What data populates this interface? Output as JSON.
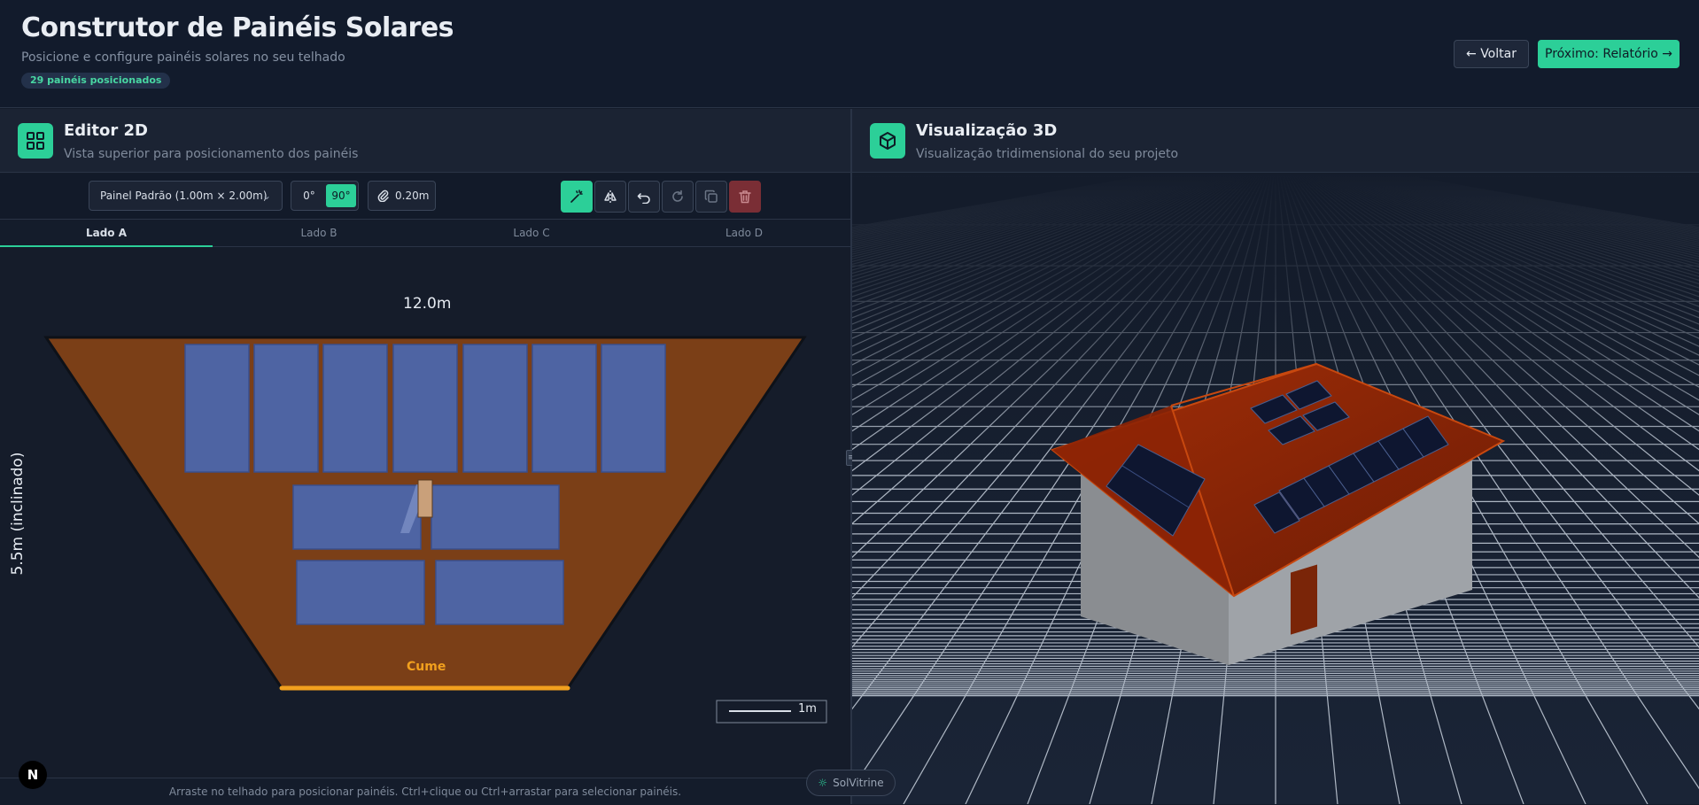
{
  "header": {
    "title": "Construtor de Painéis Solares",
    "subtitle": "Posicione e configure painéis solares no seu telhado",
    "badge": "29 painéis posicionados",
    "back_label": "← Voltar",
    "next_label": "Próximo: Relatório →"
  },
  "editor2d": {
    "title": "Editor 2D",
    "subtitle": "Vista superior para posicionamento dos painéis",
    "panel_select": "Painel Padrão (1.00m × 2.00m)",
    "rotations": [
      "0°",
      "90°"
    ],
    "spacing": "0.20m",
    "tabs": [
      "Lado A",
      "Lado B",
      "Lado C",
      "Lado D"
    ],
    "width_label": "12.0m",
    "height_label": "5.5m (inclinado)",
    "ridge_label": "Cume",
    "scale_label": "1m",
    "footer_hint": "Arraste no telhado para posicionar painéis. Ctrl+clique ou Ctrl+arrastar para selecionar painéis."
  },
  "view3d": {
    "title": "Visualização 3D",
    "subtitle": "Visualização tridimensional do seu projeto"
  },
  "brand": {
    "logo_letter": "N",
    "name": "SolVitrine"
  },
  "colors": {
    "accent": "#2ccf98",
    "roof": "#7b3f17",
    "panel": "#4e64a3",
    "ridge": "#f2a01e",
    "danger": "#7a2e35"
  }
}
